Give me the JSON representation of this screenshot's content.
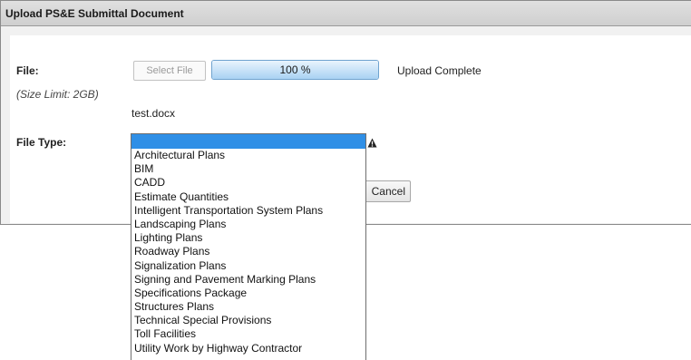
{
  "dialog": {
    "title": "Upload PS&E Submittal Document"
  },
  "form": {
    "file_label": "File:",
    "size_limit": "(Size Limit: 2GB)",
    "select_file_label": "Select File",
    "progress": {
      "percent": 100,
      "text": "100 %"
    },
    "upload_status": "Upload Complete",
    "filename": "test.docx",
    "file_type_label": "File Type:",
    "cancel_label": "Cancel",
    "warning_icon": "warning-triangle-icon"
  },
  "file_type_dropdown": {
    "selected_value": "",
    "options": [
      "Architectural Plans",
      "BIM",
      "CADD",
      "Estimate Quantities",
      "Intelligent Transportation System Plans",
      "Landscaping Plans",
      "Lighting Plans",
      "Roadway Plans",
      "Signalization Plans",
      "Signing and Pavement Marking Plans",
      "Specifications Package",
      "Structures Plans",
      "Technical Special Provisions",
      "Toll Facilities",
      "Utility Work by Highway Contractor"
    ]
  },
  "colors": {
    "selection_highlight": "#2f8fe6",
    "progress_border": "#6fa3cf",
    "progress_fill": "#a9d2f3"
  }
}
